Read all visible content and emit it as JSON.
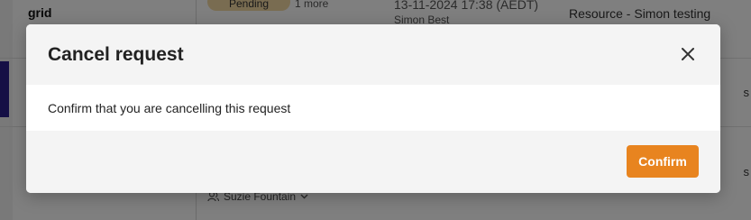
{
  "background": {
    "left_label": "grid",
    "status_pill": "Pending",
    "more_link": "1 more",
    "requester_partial": "Simon Best",
    "datetime": "13-11-2024 17:38 (AEDT)",
    "resource": "Resource - Simon testing",
    "assignee": "Suzie Fountain"
  },
  "modal": {
    "title": "Cancel request",
    "message": "Confirm that you are cancelling this request",
    "confirm_label": "Confirm"
  }
}
